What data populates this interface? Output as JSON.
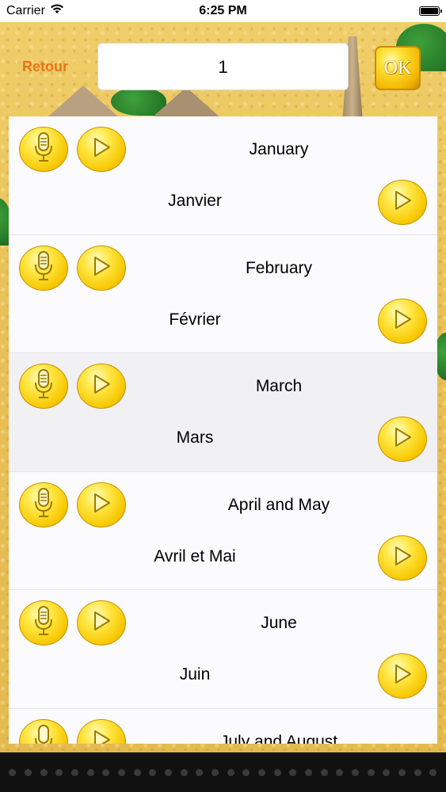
{
  "status_bar": {
    "carrier": "Carrier",
    "time": "6:25 PM",
    "wifi_icon": "wifi-icon",
    "battery_icon": "battery-icon"
  },
  "nav": {
    "back_label": "Retour",
    "number_value": "1",
    "ok_label": "OK"
  },
  "colors": {
    "accent": "#e8741a",
    "gold": "#f7c800",
    "sand": "#e9c057"
  },
  "rows": [
    {
      "english": "January",
      "french": "Janvier"
    },
    {
      "english": "February",
      "french": "Février"
    },
    {
      "english": "March",
      "french": "Mars"
    },
    {
      "english": "April and May",
      "french": "Avril et Mai"
    },
    {
      "english": "June",
      "french": "Juin"
    },
    {
      "english": "July and August",
      "french": ""
    }
  ]
}
